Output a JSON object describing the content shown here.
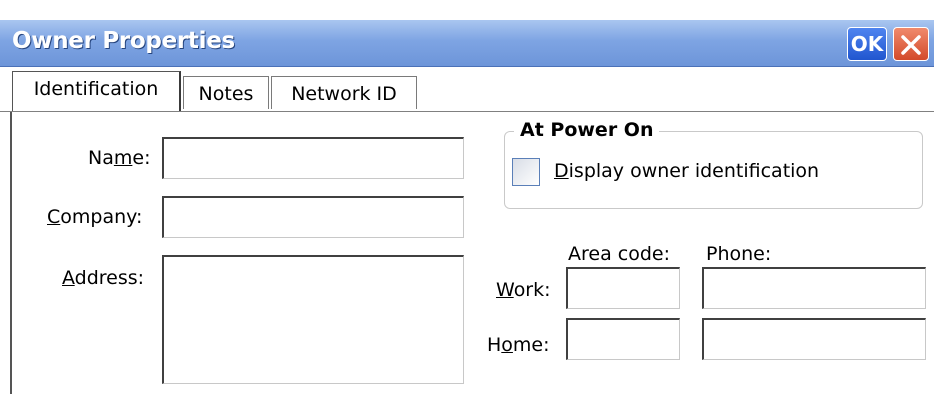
{
  "window": {
    "title": "Owner Properties",
    "ok_label": "OK"
  },
  "tabs": [
    {
      "label": "Identification",
      "active": true
    },
    {
      "label": "Notes",
      "active": false
    },
    {
      "label": "Network ID",
      "active": false
    }
  ],
  "form": {
    "name": {
      "label_pre": "Na",
      "accel": "m",
      "label_post": "e:",
      "value": ""
    },
    "company": {
      "label_pre": "",
      "accel": "C",
      "label_post": "ompany:",
      "value": ""
    },
    "address": {
      "label_pre": "",
      "accel": "A",
      "label_post": "ddress:",
      "value": ""
    }
  },
  "power_on": {
    "group_title": "At Power On",
    "checkbox": {
      "accel": "D",
      "label_post": "isplay owner identification",
      "checked": false
    }
  },
  "phones": {
    "area_code_header": "Area code:",
    "phone_header": "Phone:",
    "work": {
      "accel": "W",
      "label_post": "ork:",
      "area_code": "",
      "phone": ""
    },
    "home": {
      "label_pre": "H",
      "accel": "o",
      "label_post": "me:",
      "area_code": "",
      "phone": ""
    }
  }
}
